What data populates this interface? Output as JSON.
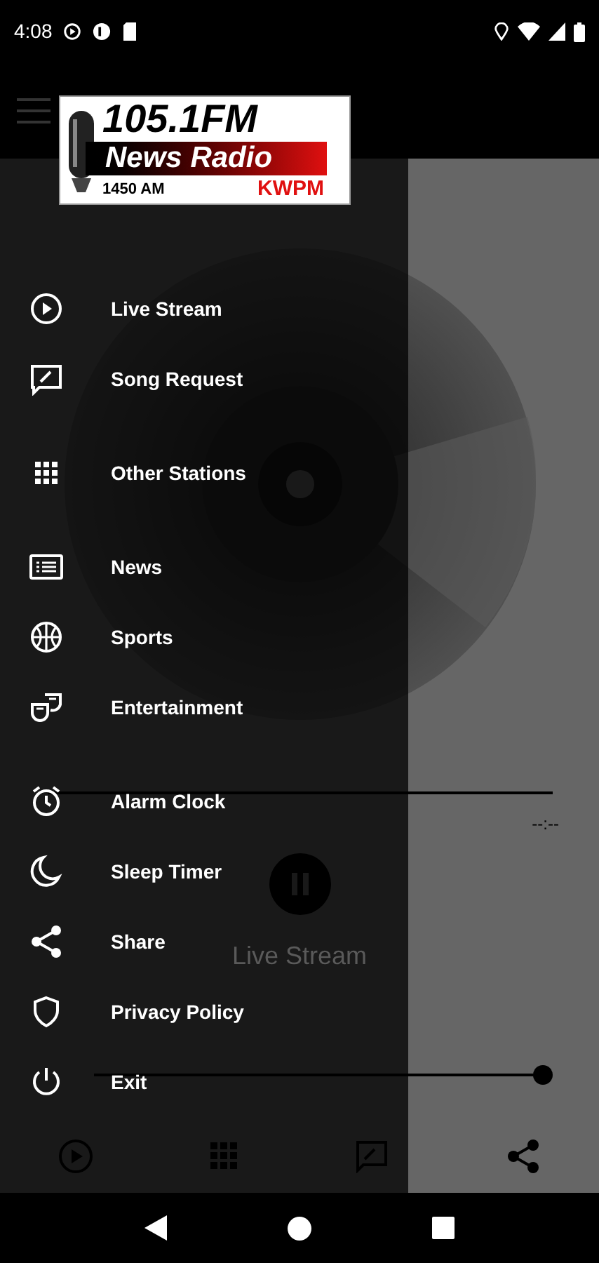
{
  "status_bar": {
    "time": "4:08"
  },
  "logo": {
    "frequency": "105.1FM",
    "name": "News Radio",
    "am": "1450 AM",
    "call_sign": "KWPM"
  },
  "drawer": {
    "sections": [
      [
        {
          "label": "Live Stream",
          "kind": "play"
        },
        {
          "label": "Song Request",
          "kind": "request"
        }
      ],
      [
        {
          "label": "Other Stations",
          "kind": "grid"
        }
      ],
      [
        {
          "label": "News",
          "kind": "news"
        },
        {
          "label": "Sports",
          "kind": "sports"
        },
        {
          "label": "Entertainment",
          "kind": "entertainment"
        }
      ],
      [
        {
          "label": "Alarm Clock",
          "kind": "alarm"
        },
        {
          "label": "Sleep Timer",
          "kind": "moon"
        },
        {
          "label": "Share",
          "kind": "share"
        },
        {
          "label": "Privacy Policy",
          "kind": "shield"
        },
        {
          "label": "Exit",
          "kind": "power"
        }
      ]
    ]
  },
  "player": {
    "elapsed": "--:--",
    "title": "Live Stream",
    "playing": true,
    "volume": {
      "level": 1
    }
  }
}
